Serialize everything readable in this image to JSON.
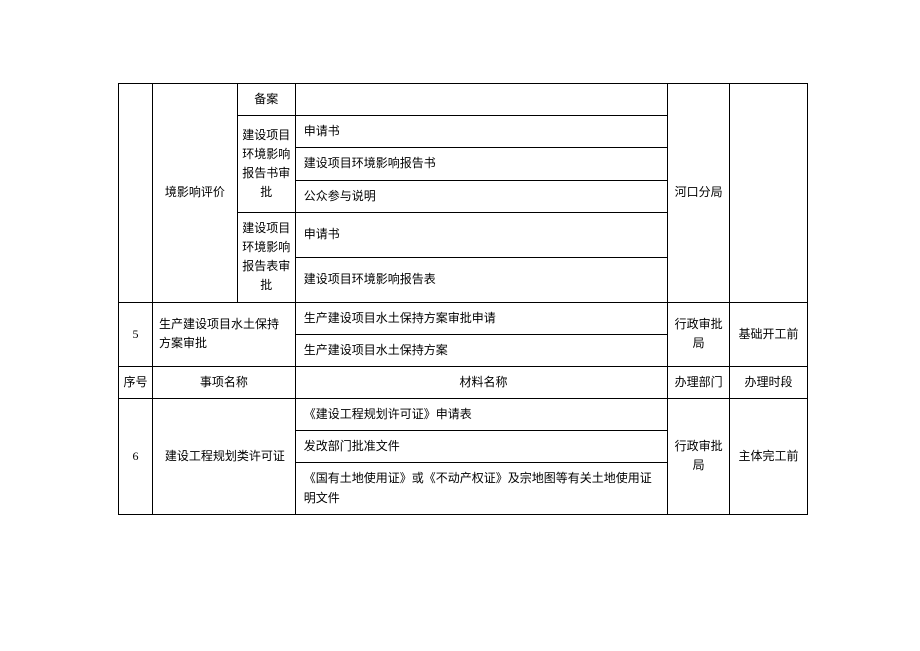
{
  "rows_top": {
    "row1": {
      "col1_partial": "境影响评价",
      "subitem": "备案",
      "material": "",
      "dept": "河口分局",
      "time": ""
    },
    "row2": {
      "subitem": "建设项目环境影响报告书审批",
      "materials": [
        "申请书",
        "建设项目环境影响报告书",
        "公众参与说明"
      ]
    },
    "row3": {
      "subitem": "建设项目环境影响报告表审批",
      "materials": [
        "申请书",
        "建设项目环境影响报告表"
      ]
    }
  },
  "row5": {
    "seq": "5",
    "item": "生产建设项目水土保持方案审批",
    "materials": [
      "生产建设项目水土保持方案审批申请",
      "生产建设项目水土保持方案"
    ],
    "dept": "行政审批局",
    "time": "基础开工前"
  },
  "header": {
    "seq": "序号",
    "item": "事项名称",
    "material": "材料名称",
    "dept": "办理部门",
    "time": "办理时段"
  },
  "row6": {
    "seq": "6",
    "item": "建设工程规划类许可证",
    "materials": [
      "《建设工程规划许可证》申请表",
      "发改部门批准文件",
      "《国有土地使用证》或《不动产权证》及宗地图等有关土地使用证明文件"
    ],
    "dept": "行政审批局",
    "time": "主体完工前"
  }
}
